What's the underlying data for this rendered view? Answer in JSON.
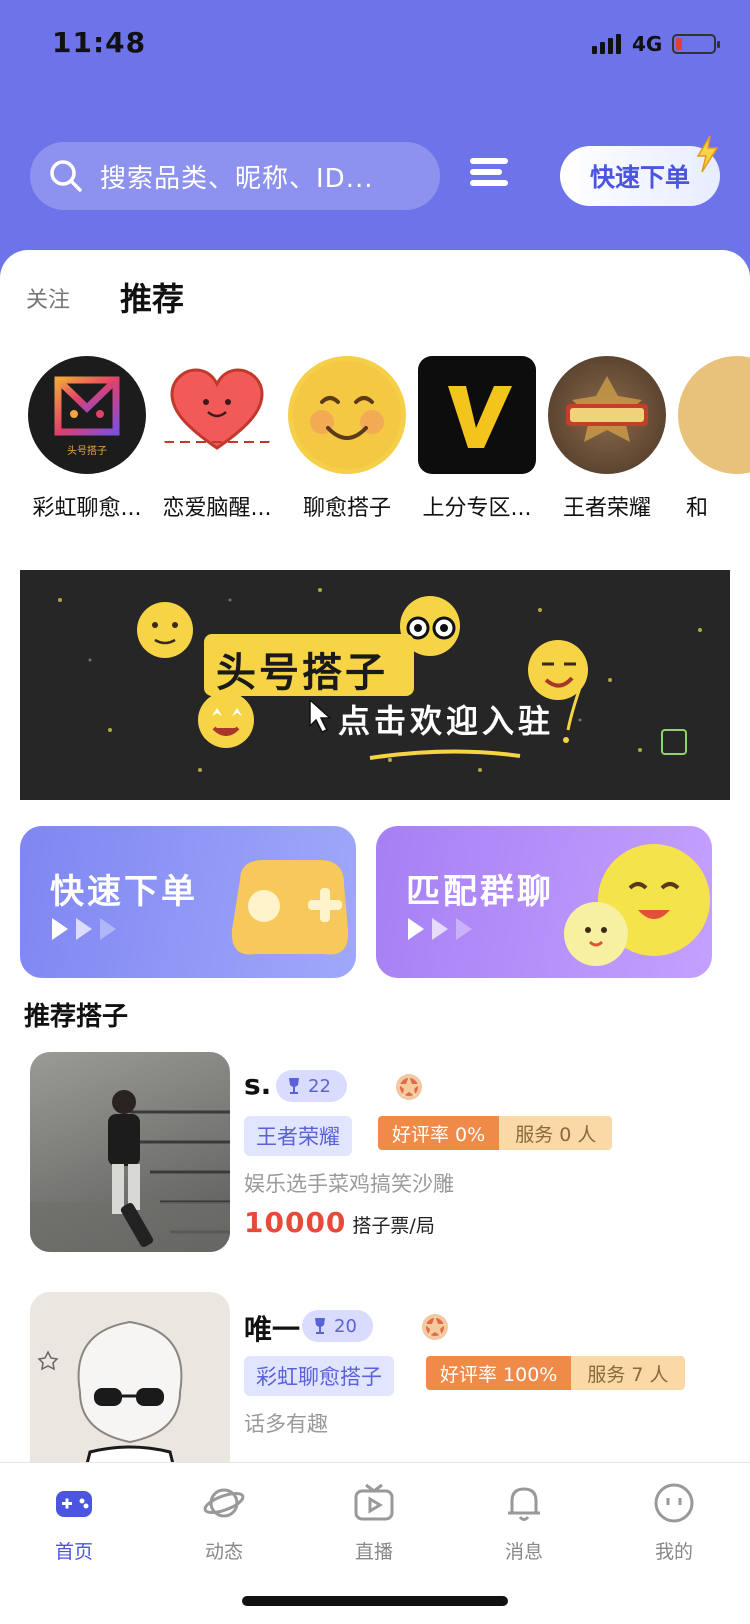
{
  "status_bar": {
    "time": "11:48",
    "network": "4G"
  },
  "search": {
    "placeholder": "搜索品类、昵称、ID..."
  },
  "header": {
    "quick_order": "快速下单"
  },
  "tabs": {
    "follow": "关注",
    "recommend": "推荐"
  },
  "categories": [
    {
      "label": "彩虹聊愈...",
      "icon": "rainbow-box-logo",
      "logo_text": "头号搭子"
    },
    {
      "label": "恋爱脑醒...",
      "icon": "heart-icon"
    },
    {
      "label": "聊愈搭子",
      "icon": "smiley-icon"
    },
    {
      "label": "上分专区...",
      "icon": "v-logo"
    },
    {
      "label": "王者荣耀",
      "icon": "honor-of-kings-logo"
    },
    {
      "label": "和",
      "icon": "partial-category"
    }
  ],
  "banner": {
    "title": "头号搭子",
    "subtitle": "点击欢迎入驻"
  },
  "promos": [
    {
      "title": "快速下单",
      "icon": "gamepad-icon"
    },
    {
      "title": "匹配群聊",
      "icon": "smiley-group-icon"
    }
  ],
  "section_title": "推荐搭子",
  "players": [
    {
      "name": "s.",
      "level": "22",
      "game": "王者荣耀",
      "rating": "好评率 0%",
      "served": "服务 0 人",
      "desc": "娱乐选手菜鸡搞笑沙雕",
      "price": "10000",
      "unit": "搭子票/局"
    },
    {
      "name": "唯一",
      "level": "20",
      "game": "彩虹聊愈搭子",
      "rating": "好评率 100%",
      "served": "服务 7 人",
      "desc": "话多有趣",
      "price": "",
      "unit": ""
    }
  ],
  "tabbar": [
    {
      "label": "首页",
      "icon": "gamepad-icon",
      "active": true
    },
    {
      "label": "动态",
      "icon": "planet-icon",
      "active": false
    },
    {
      "label": "直播",
      "icon": "tv-play-icon",
      "active": false
    },
    {
      "label": "消息",
      "icon": "bell-icon",
      "active": false
    },
    {
      "label": "我的",
      "icon": "face-icon",
      "active": false
    }
  ],
  "colors": {
    "header": "#6d74ea",
    "accent": "#4b55e0",
    "price": "#e54a3a",
    "rating": "#f08a48"
  }
}
